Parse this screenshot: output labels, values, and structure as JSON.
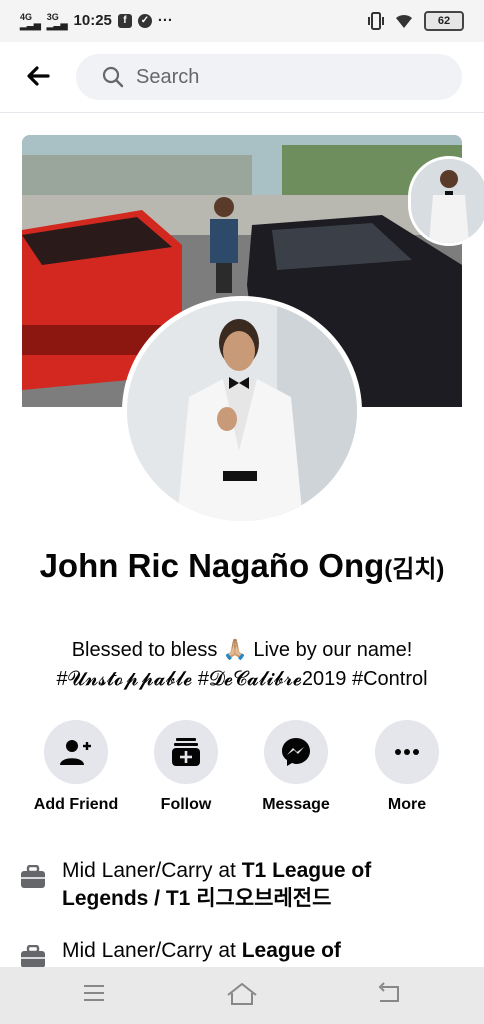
{
  "status_bar": {
    "net1": "4G",
    "net2": "3G",
    "time": "10:25",
    "dots": "···",
    "battery": "62"
  },
  "search": {
    "placeholder": "Search"
  },
  "profile": {
    "name": "John Ric Nagaño Ong",
    "name_suffix": "(김치)",
    "bio_line1": "Blessed to bless 🙏🏼 Live by our name!",
    "bio_line2": "#𝓤𝓷𝓼𝓽𝓸𝓹𝓹𝓪𝓫𝓵𝓮 #𝓓𝓮𝓒𝓪𝓵𝓲𝓫𝓻𝓮2019 #Control"
  },
  "actions": [
    {
      "label": "Add Friend",
      "icon": "add-friend-icon"
    },
    {
      "label": "Follow",
      "icon": "follow-icon"
    },
    {
      "label": "Message",
      "icon": "messenger-icon"
    },
    {
      "label": "More",
      "icon": "more-icon"
    }
  ],
  "info": [
    {
      "prefix": "Mid Laner/Carry at ",
      "org": "T1 League of Legends / T1 리그오브레전드",
      "icon": "briefcase-icon"
    },
    {
      "prefix": "Mid Laner/Carry at ",
      "org": "League of",
      "icon": "briefcase-icon"
    }
  ],
  "colors": {
    "accent": "#050505",
    "button_bg": "#e4e6eb",
    "search_bg": "#f0f2f5"
  }
}
